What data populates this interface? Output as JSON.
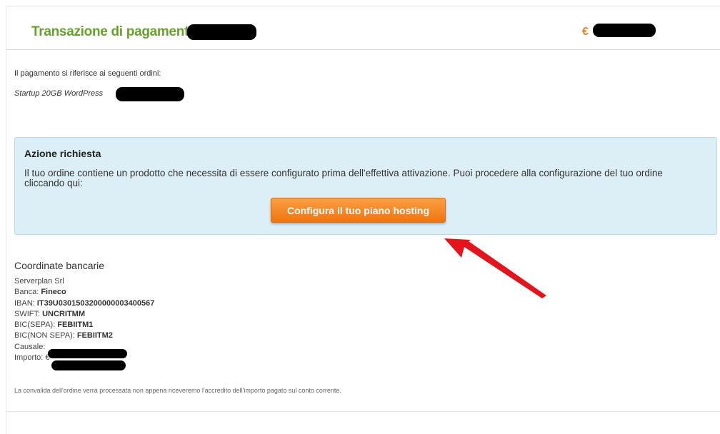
{
  "header": {
    "title": "Transazione di pagamento n.",
    "currency_symbol": "€"
  },
  "orders": {
    "intro": "Il pagamento si riferisce ai seguenti ordini:",
    "item": "Startup 20GB WordPress"
  },
  "alert": {
    "title": "Azione richiesta",
    "text": "Il tuo ordine contiene un prodotto che necessita di essere configurato prima dell'effettiva attivazione. Puoi procedere alla configurazione del tuo ordine cliccando qui:",
    "button_label": "Configura il tuo piano hosting"
  },
  "bank": {
    "section_title": "Coordinate bancarie",
    "company": "Serverplan Srl",
    "bank_label": "Banca: ",
    "bank_value": "Fineco",
    "iban_label": "IBAN: ",
    "iban_value": "IT39U0301503200000003400567",
    "swift_label": "SWIFT: ",
    "swift_value": "UNCRITMM",
    "bic_sepa_label": "BIC(SEPA): ",
    "bic_sepa_value": "FEBIITM1",
    "bic_nonsepa_label": "BIC(NON SEPA): ",
    "bic_nonsepa_value": "FEBIITM2",
    "causale_label": "Causale:",
    "importo_label": "Importo: €"
  },
  "note": "La convalida dell'ordine verrà processata non appena riceveremo l'accredito dell'importo pagato sul conto corrente.",
  "colors": {
    "title_green": "#66a22b",
    "accent_orange": "#f0801f",
    "alert_bg": "#dceef6",
    "arrow_red": "#e3141b"
  }
}
